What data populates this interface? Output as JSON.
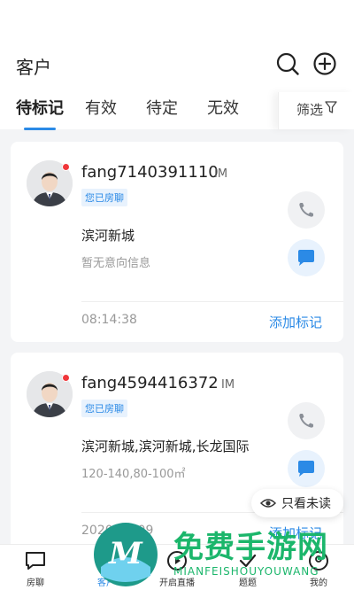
{
  "header": {
    "title": "客户",
    "icons": [
      "search-icon",
      "add-circle-icon"
    ]
  },
  "tabs": [
    {
      "label": "待标记",
      "active": true
    },
    {
      "label": "有效",
      "active": false
    },
    {
      "label": "待定",
      "active": false
    },
    {
      "label": "无效",
      "active": false
    }
  ],
  "filter": {
    "label": "筛选",
    "icon": "funnel-icon"
  },
  "customers": [
    {
      "name": "fang7140391110",
      "im_tag": "IM",
      "badge": "您已房聊",
      "address": "滨河新城",
      "subinfo": "暂无意向信息",
      "time": "08:14:38",
      "action": "添加标记"
    },
    {
      "name": "fang4594416372",
      "im_tag": "IM",
      "badge": "您已房聊",
      "address": "滨河新城,滨河新城,长龙国际",
      "subinfo": "120-140,80-100㎡",
      "time": "2020-09-09",
      "action": "添加标记"
    }
  ],
  "unread_toggle": {
    "label": "只看未读",
    "icon": "eye-icon"
  },
  "tabbar": [
    {
      "label": "房聊",
      "icon": "chat-icon",
      "active": false
    },
    {
      "label": "客户",
      "icon": "customer-icon",
      "active": true
    },
    {
      "label": "开启直播",
      "icon": "live-icon",
      "active": false
    },
    {
      "label": "题题",
      "icon": "check-icon",
      "active": false
    },
    {
      "label": "我的",
      "icon": "user-icon",
      "active": false
    }
  ],
  "watermark": {
    "text": "免费手游网",
    "url": "MIANFEISHOUYOUWANG"
  },
  "colors": {
    "accent": "#2b8ae6",
    "badge_bg": "#e8f2fd",
    "dot": "#f0373b",
    "watermark": "#1bb66b"
  }
}
